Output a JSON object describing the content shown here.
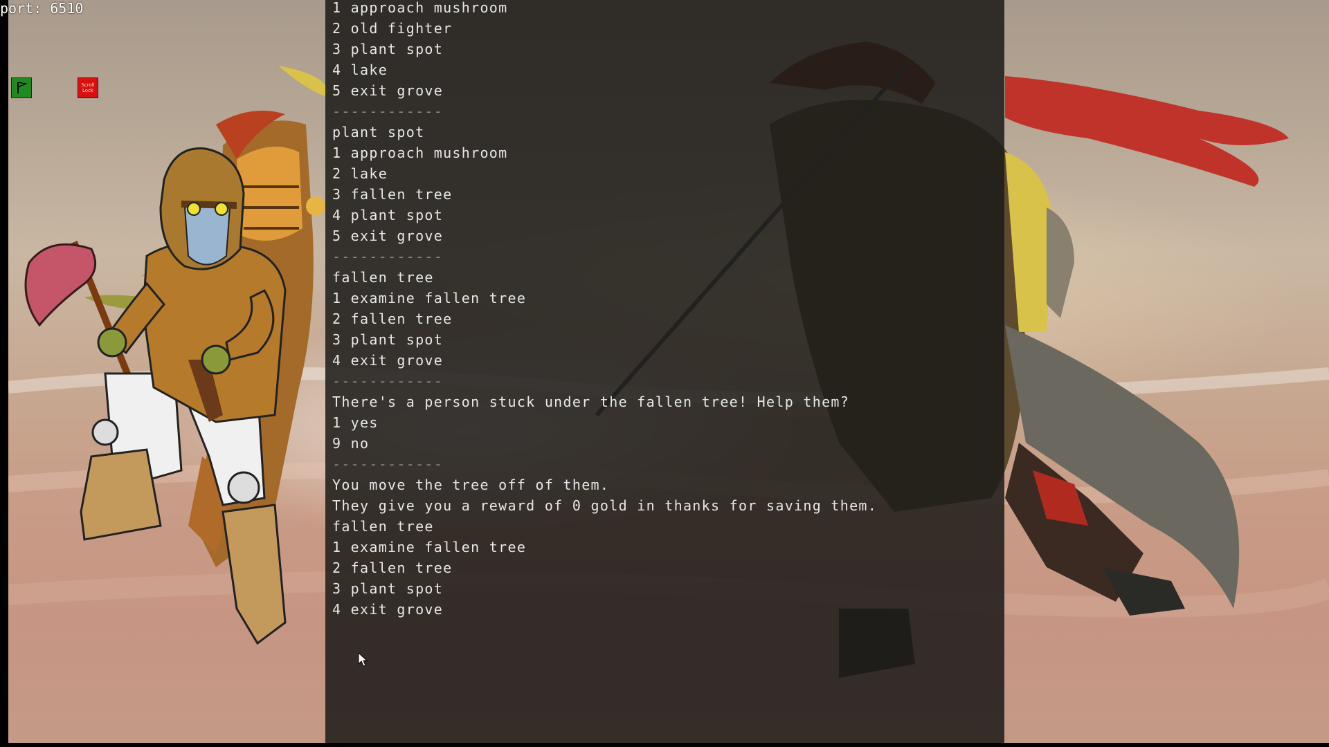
{
  "hud": {
    "port_text": "port: 6510",
    "scroll_lock_label": "Scroll Lock"
  },
  "console": {
    "lines": [
      "1 approach mushroom",
      "2 old fighter",
      "3 plant spot",
      "4 lake",
      "5 exit grove",
      "------------",
      "plant spot",
      "1 approach mushroom",
      "2 lake",
      "3 fallen tree",
      "4 plant spot",
      "5 exit grove",
      "------------",
      "fallen tree",
      "1 examine fallen tree",
      "2 fallen tree",
      "3 plant spot",
      "4 exit grove",
      "------------",
      "There's a person stuck under the fallen tree! Help them?",
      "1 yes",
      "9 no",
      "------------",
      "You move the tree off of them.",
      "They give you a reward of 0 gold in thanks for saving them.",
      "fallen tree",
      "1 examine fallen tree",
      "2 fallen tree",
      "3 plant spot",
      "4 exit grove"
    ]
  },
  "colors": {
    "console_text": "#e8e8e8",
    "console_bg": "#1c1b19",
    "flag_green": "#1f8a1f",
    "scroll_lock_red": "#d81010"
  }
}
